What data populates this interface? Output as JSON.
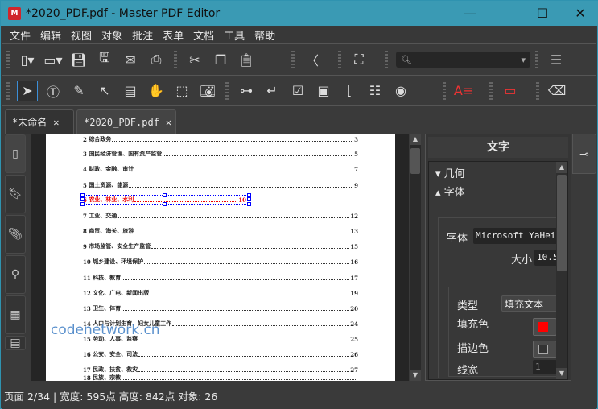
{
  "window": {
    "title": "*2020_PDF.pdf - Master PDF Editor",
    "minimize": "—",
    "maximize": "☐",
    "close": "✕"
  },
  "menu": [
    "文件",
    "编辑",
    "视图",
    "对象",
    "批注",
    "表单",
    "文档",
    "工具",
    "帮助"
  ],
  "tabs": [
    {
      "label": "*未命名",
      "close": "✕"
    },
    {
      "label": "*2020_PDF.pdf",
      "close": "✕"
    }
  ],
  "toc": [
    {
      "num": "2",
      "text": "综合政务",
      "page": "3"
    },
    {
      "num": "3",
      "text": "国民经济管理、国有资产监管",
      "page": "5"
    },
    {
      "num": "4",
      "text": "财政、金融、审计",
      "page": "7"
    },
    {
      "num": "5",
      "text": "国土资源、能源",
      "page": "9"
    },
    {
      "num": "6",
      "text": "农业、林业、水利",
      "page": "10",
      "selected": true
    },
    {
      "num": "7",
      "text": "工业、交通",
      "page": "12"
    },
    {
      "num": "8",
      "text": "商贸、海关、旅游",
      "page": "13"
    },
    {
      "num": "9",
      "text": "市场监管、安全生产监管",
      "page": "15"
    },
    {
      "num": "10",
      "text": "城乡建设、环境保护",
      "page": "16"
    },
    {
      "num": "11",
      "text": "科技、教育",
      "page": "17"
    },
    {
      "num": "12",
      "text": "文化、广电、新闻出版",
      "page": "19"
    },
    {
      "num": "13",
      "text": "卫生、体育",
      "page": "20"
    },
    {
      "num": "14",
      "text": "人口与计划生育、妇女儿童工作",
      "page": "24"
    },
    {
      "num": "15",
      "text": "劳动、人事、监察",
      "page": "25"
    },
    {
      "num": "16",
      "text": "公安、安全、司法",
      "page": "26"
    },
    {
      "num": "17",
      "text": "民政、扶贫、救灾",
      "page": "27"
    },
    {
      "num": "18",
      "text": "民族、宗教",
      "page": ""
    }
  ],
  "watermark": "codenetwork.cn",
  "panel": {
    "title": "文字",
    "geometry": "几何",
    "font_section": "字体",
    "font_label": "字体",
    "font_value": "Microsoft YaHei",
    "size_label": "大小",
    "size_value": "10.5",
    "type_label": "类型",
    "type_value": "填充文本",
    "fill_label": "填充色",
    "stroke_label": "描边色",
    "linewidth_label": "线宽",
    "linewidth_value": "1",
    "fill_color": "#ff0000"
  },
  "status": "页面 2/34 | 宽度: 595点 高度: 842点 对象: 26"
}
